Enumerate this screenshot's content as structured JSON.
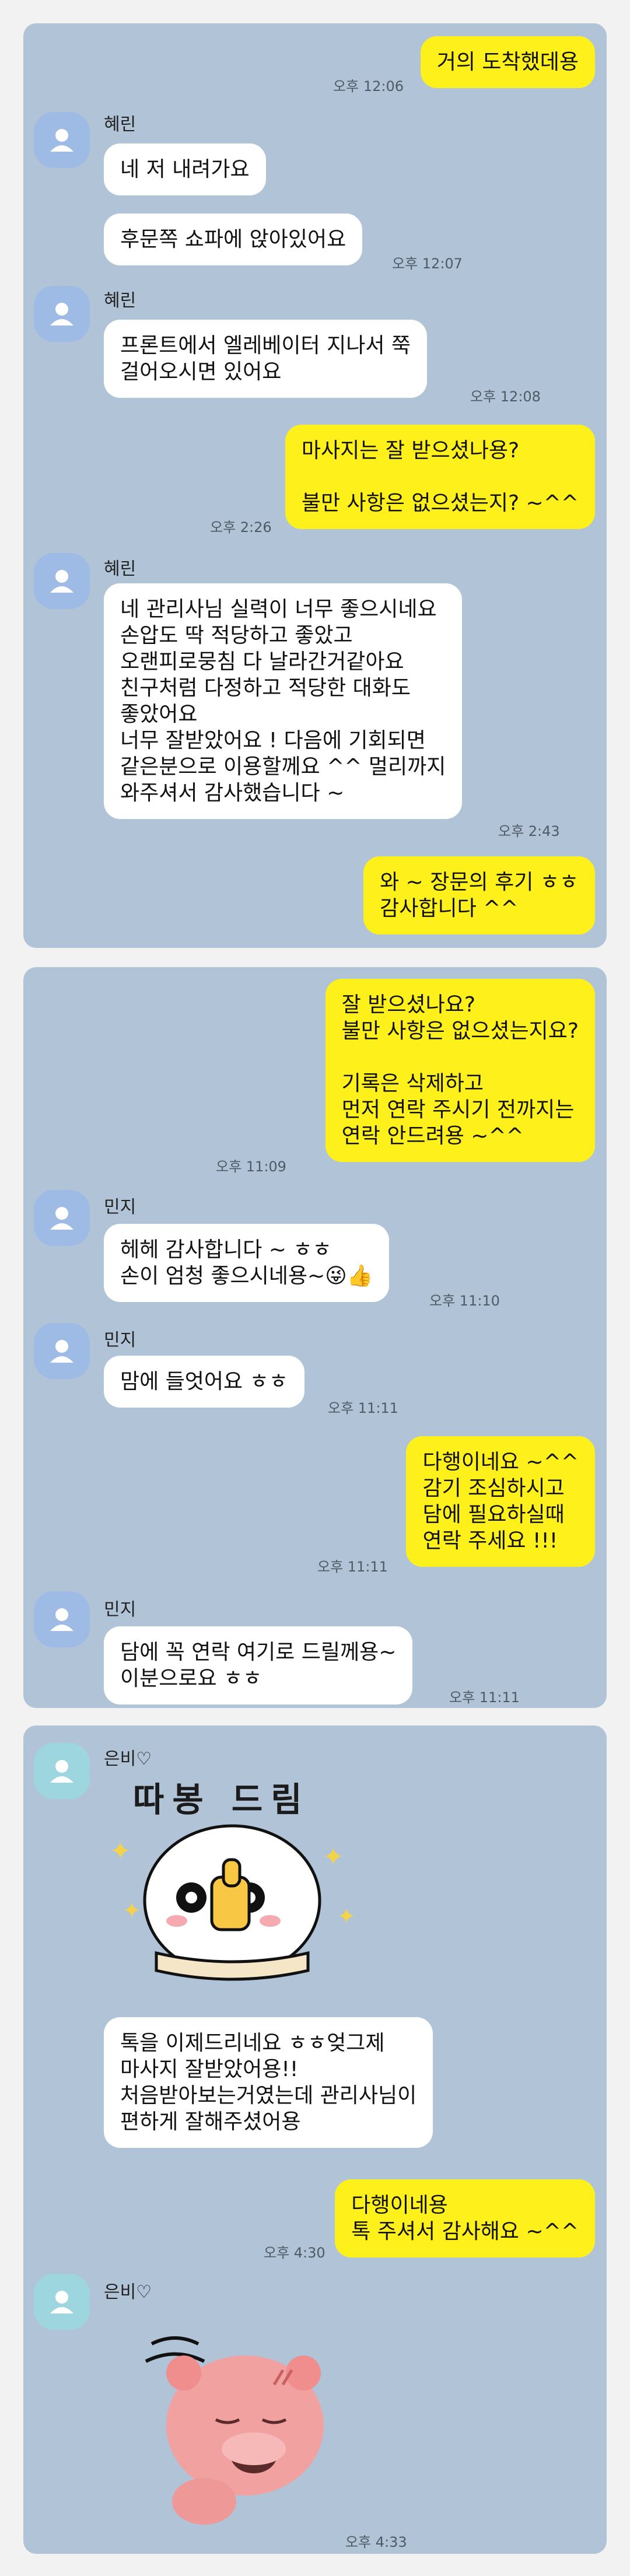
{
  "panel1": {
    "m1": {
      "text": "거의 도착했데용",
      "time": "오후 12:06"
    },
    "hyerin1": {
      "name": "혜린"
    },
    "m2": {
      "text": "네 저 내려가요"
    },
    "m3": {
      "text": "후문쪽 쇼파에 앉아있어요",
      "time": "오후 12:07"
    },
    "hyerin2": {
      "name": "혜린"
    },
    "m4": {
      "text": "프론트에서 엘레베이터 지나서 쭉\n걸어오시면 있어요",
      "time": "오후 12:08"
    },
    "m5": {
      "text": "마사지는 잘 받으셨나용?\n\n불만 사항은 없으셨는지? ~^^",
      "time": "오후 2:26"
    },
    "hyerin3": {
      "name": "혜린"
    },
    "m6": {
      "text": "네 관리사님 실력이 너무 좋으시네요\n손압도 딱 적당하고 좋았고\n오랜피로뭉침 다 날라간거같아요\n친구처럼 다정하고 적당한 대화도\n좋았어요\n너무 잘받았어요 ! 다음에 기회되면\n같은분으로 이용할께요 ^^ 멀리까지\n와주셔서 감사했습니다 ~",
      "time": "오후 2:43"
    },
    "m7": {
      "text": "와 ~ 장문의 후기 ㅎㅎ\n감사합니다 ^^"
    }
  },
  "panel2": {
    "m1": {
      "text": "잘 받으셨나요?\n불만 사항은 없으셨는지요?\n\n기록은 삭제하고\n먼저 연락 주시기 전까지는\n연락 안드려용 ~^^",
      "time": "오후 11:09"
    },
    "minji1": {
      "name": "민지"
    },
    "m2": {
      "text": "헤헤 감사합니다 ~ ㅎㅎ\n손이 엄청 좋으시네용~😜👍",
      "time": "오후 11:10"
    },
    "minji2": {
      "name": "민지"
    },
    "m3": {
      "text": "맘에 들엇어요 ㅎㅎ",
      "time": "오후 11:11"
    },
    "m4": {
      "text": "다행이네요 ~^^\n감기 조심하시고\n담에 필요하실때\n연락 주세요 !!!",
      "time": "오후 11:11"
    },
    "minji3": {
      "name": "민지"
    },
    "m5": {
      "text": "담에 꼭 연락 여기로 드릴께용~\n이분으로요 ㅎㅎ",
      "time": "오후 11:11"
    }
  },
  "panel3": {
    "eunbi1": {
      "name": "은비♡"
    },
    "sticker1": {
      "text": "따봉 드림",
      "icon": "thumbs-up-sticker"
    },
    "m1": {
      "text": "톡을 이제드리네요 ㅎㅎ엊그제\n마사지 잘받았어용!!\n처음받아보는거였는데 관리사님이\n편하게 잘해주셨어용"
    },
    "m2": {
      "text": "다행이네용\n톡 주셔서 감사해요 ~^^",
      "time": "오후 4:30"
    },
    "eunbi2": {
      "name": "은비♡"
    },
    "sticker2": {
      "icon": "pink-character-sticker",
      "time": "오후 4:33"
    }
  },
  "colors": {
    "panel_bg": "#b1c3d6",
    "incoming_bubble": "#ffffff",
    "outgoing_bubble": "#fef01b",
    "avatar_blue": "#9ebbe6",
    "avatar_teal": "#9ed6e0"
  }
}
